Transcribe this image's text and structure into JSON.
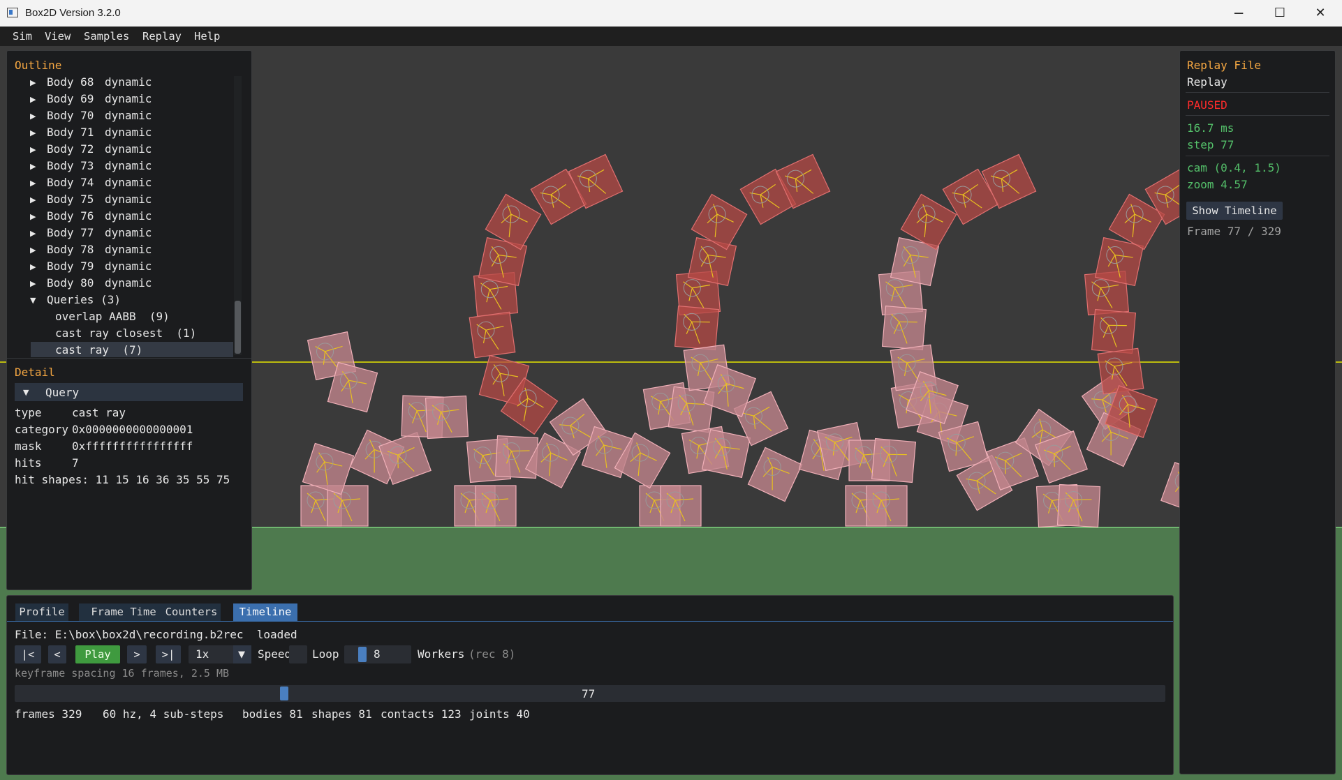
{
  "window": {
    "title": "Box2D Version 3.2.0",
    "minimize": "─",
    "maximize": "☐",
    "close": "✕"
  },
  "menu": [
    "Sim",
    "View",
    "Samples",
    "Replay",
    "Help"
  ],
  "outline": {
    "header": "Outline",
    "bodies": [
      {
        "name": "Body 68",
        "type": "dynamic"
      },
      {
        "name": "Body 69",
        "type": "dynamic"
      },
      {
        "name": "Body 70",
        "type": "dynamic"
      },
      {
        "name": "Body 71",
        "type": "dynamic"
      },
      {
        "name": "Body 72",
        "type": "dynamic"
      },
      {
        "name": "Body 73",
        "type": "dynamic"
      },
      {
        "name": "Body 74",
        "type": "dynamic"
      },
      {
        "name": "Body 75",
        "type": "dynamic"
      },
      {
        "name": "Body 76",
        "type": "dynamic"
      },
      {
        "name": "Body 77",
        "type": "dynamic"
      },
      {
        "name": "Body 78",
        "type": "dynamic"
      },
      {
        "name": "Body 79",
        "type": "dynamic"
      },
      {
        "name": "Body 80",
        "type": "dynamic"
      }
    ],
    "queries_label": "Queries (3)",
    "queries": [
      "overlap AABB  (9)",
      "cast ray closest  (1)",
      "cast ray  (7)"
    ]
  },
  "detail": {
    "header": "Detail",
    "section": "Query",
    "fields": [
      {
        "key": "type",
        "value": "cast ray"
      },
      {
        "key": "category",
        "value": "0x0000000000000001"
      },
      {
        "key": "mask",
        "value": "0xffffffffffffffff"
      },
      {
        "key": "hits",
        "value": "7"
      }
    ],
    "hit_shapes": "hit shapes: 11 15 16 36 35 55 75"
  },
  "replay_panel": {
    "header": "Replay File",
    "name": "Replay",
    "state": "PAUSED",
    "ms": "16.7 ms",
    "step": "step 77",
    "cam": "cam (0.4, 1.5)",
    "zoom": "zoom 4.57",
    "show_timeline": "Show Timeline",
    "frame": "Frame 77 / 329"
  },
  "bottom": {
    "tabs": [
      "Profile",
      "Frame Time",
      "Counters",
      "Timeline"
    ],
    "file_line": "File: E:\\box\\box2d\\recording.b2rec  loaded",
    "controls": {
      "first": "|<",
      "prev": "<",
      "play": "Play",
      "next": ">",
      "last": ">|",
      "speed_value": "1x",
      "speed_label": "Speed",
      "loop_label": "Loop",
      "workers_value": "8",
      "workers_label": "Workers",
      "workers_rec": "(rec 8)"
    },
    "keyframe": "keyframe spacing 16 frames, 2.5 MB",
    "timeline_frame": 77,
    "timeline_total": 329,
    "stats": {
      "frames": "frames 329",
      "hz": "60 hz, 4 sub-steps",
      "bodies": "bodies 81",
      "shapes": "shapes 81",
      "contacts": "contacts 123",
      "joints": "joints 40"
    }
  },
  "colors": {
    "background": "#3a3a3a",
    "ground": "#4e7a4e",
    "box_fill": "#c1858c",
    "box_sleep": "#b54a45",
    "raycast": "#ffff00"
  }
}
